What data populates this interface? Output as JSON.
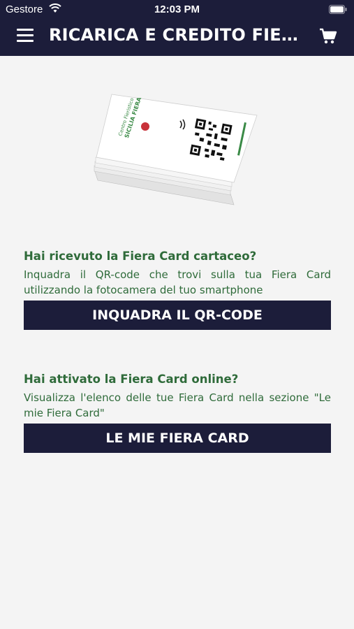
{
  "status_bar": {
    "carrier": "Gestore",
    "time": "12:03 PM"
  },
  "header": {
    "title": "RICARICA E CREDITO FIERA CARD",
    "menu_icon": "hamburger-menu-icon",
    "cart_icon": "shopping-cart-icon"
  },
  "card_image": {
    "logo_line1": "Centro Fieristico",
    "logo_line2": "SICILIA FIERA"
  },
  "sections": [
    {
      "heading": "Hai ricevuto la Fiera Card cartaceo?",
      "text": "Inquadra il QR-code che trovi sulla tua Fiera Card utilizzando la fotocamera del tuo smartphone",
      "button": "INQUADRA IL QR-CODE"
    },
    {
      "heading": "Hai attivato la Fiera Card online?",
      "text": "Visualizza l'elenco delle tue Fiera Card nella sezione \"Le mie Fiera Card\"",
      "button": "LE MIE FIERA CARD"
    }
  ],
  "colors": {
    "header_bg": "#1c1d3a",
    "heading_green": "#2f6b3a",
    "background": "#f4f4f4"
  }
}
